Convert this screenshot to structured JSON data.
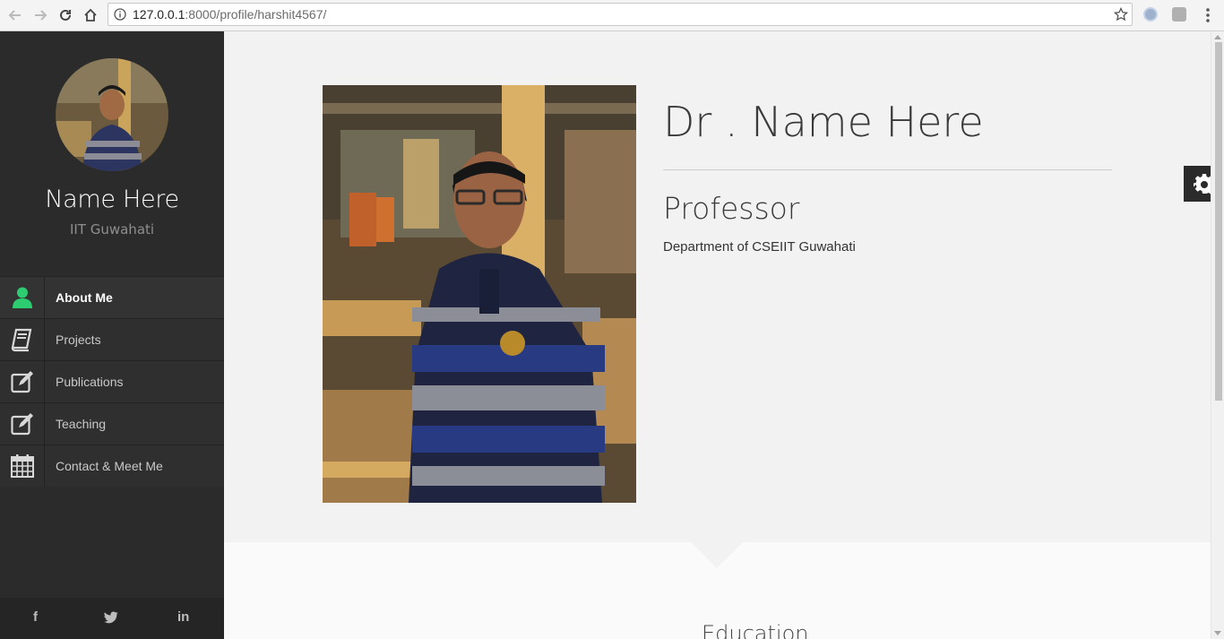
{
  "browser": {
    "url_host": "127.0.0.1",
    "url_rest": ":8000/profile/harshit4567/"
  },
  "sidebar": {
    "name": "Name Here",
    "institution": "IIT Guwahati",
    "nav": [
      {
        "label": "About Me",
        "icon": "user-icon",
        "active": true
      },
      {
        "label": "Projects",
        "icon": "book-icon",
        "active": false
      },
      {
        "label": "Publications",
        "icon": "edit-icon",
        "active": false
      },
      {
        "label": "Teaching",
        "icon": "edit-icon",
        "active": false
      },
      {
        "label": "Contact & Meet Me",
        "icon": "calendar-icon",
        "active": false
      }
    ],
    "social": [
      {
        "label": "f",
        "icon": "facebook-icon"
      },
      {
        "label": "🐦",
        "icon": "twitter-icon"
      },
      {
        "label": "in",
        "icon": "linkedin-icon"
      }
    ]
  },
  "main": {
    "title": "Dr . Name Here",
    "position": "Professor",
    "department": "Department of CSEIIT Guwahati",
    "next_section": "Education"
  },
  "colors": {
    "accent": "#2ecc71",
    "sidebar_bg": "#2b2b2b"
  }
}
